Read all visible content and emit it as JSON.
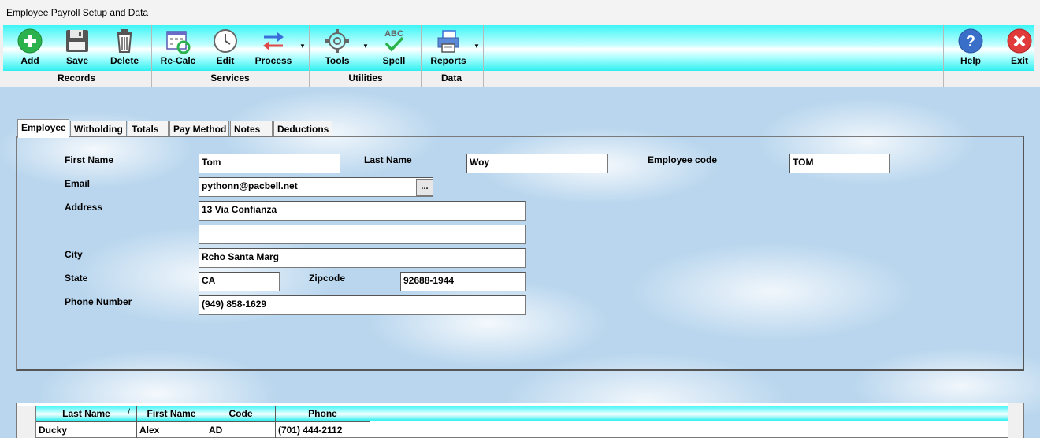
{
  "window": {
    "title": "Employee Payroll Setup and Data"
  },
  "toolbar": {
    "buttons": [
      {
        "label": "Add",
        "icon": "add-icon"
      },
      {
        "label": "Save",
        "icon": "floppy-disk-icon"
      },
      {
        "label": "Delete",
        "icon": "trash-icon"
      },
      {
        "label": "Re-Calc",
        "icon": "recalc-calendar-icon"
      },
      {
        "label": "Edit",
        "icon": "clock-icon"
      },
      {
        "label": "Process",
        "icon": "arrows-swap-icon"
      },
      {
        "label": "Tools",
        "icon": "gear-icon"
      },
      {
        "label": "Spell",
        "icon": "abc-check-icon"
      },
      {
        "label": "Reports",
        "icon": "printer-icon"
      },
      {
        "label": "Help",
        "icon": "help-icon"
      },
      {
        "label": "Exit",
        "icon": "exit-icon"
      }
    ],
    "groups": [
      "Records",
      "Services",
      "Utilities",
      "Data"
    ],
    "colors": {
      "accent": "#2ff0f0",
      "add": "#2bb24c",
      "help": "#3a6fc9",
      "exit": "#e03a3a"
    }
  },
  "tabs": [
    "Employee",
    "Witholding",
    "Totals",
    "Pay Method",
    "Notes",
    "Deductions"
  ],
  "form": {
    "first_name": {
      "label": "First Name",
      "value": "Tom"
    },
    "last_name": {
      "label": "Last Name",
      "value": "Woy"
    },
    "employee_code": {
      "label": "Employee code",
      "value": "TOM"
    },
    "email": {
      "label": "Email",
      "value": "pythonn@pacbell.net",
      "button": "..."
    },
    "address": {
      "label": "Address",
      "line1": "13 Via Confianza",
      "line2": ""
    },
    "city": {
      "label": "City",
      "value": "Rcho Santa Marg"
    },
    "state": {
      "label": "State",
      "value": "CA"
    },
    "zipcode": {
      "label": "Zipcode",
      "value": "92688-1944"
    },
    "phone": {
      "label": "Phone Number",
      "value": "(949) 858-1629"
    }
  },
  "grid": {
    "columns": [
      "Last Name",
      "First Name",
      "Code",
      "Phone"
    ],
    "sort_indicator": "/",
    "rows": [
      [
        "Ducky",
        "Alex",
        "AD",
        "(701) 444-2112"
      ]
    ]
  }
}
